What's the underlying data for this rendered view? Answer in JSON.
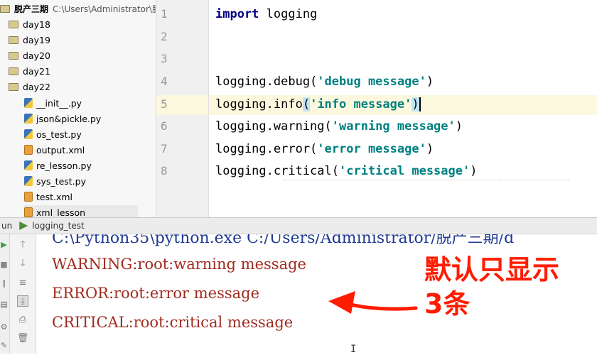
{
  "project_tree": {
    "root_label": "脱产三期",
    "root_path": "C:\\Users\\Administrator\\脱",
    "items": [
      {
        "label": "day18",
        "type": "folder"
      },
      {
        "label": "day19",
        "type": "folder"
      },
      {
        "label": "day20",
        "type": "folder"
      },
      {
        "label": "day21",
        "type": "folder"
      },
      {
        "label": "day22",
        "type": "folder"
      },
      {
        "label": "__init__.py",
        "type": "py"
      },
      {
        "label": "json&pickle.py",
        "type": "py"
      },
      {
        "label": "os_test.py",
        "type": "py"
      },
      {
        "label": "output.xml",
        "type": "xml"
      },
      {
        "label": "re_lesson.py",
        "type": "py"
      },
      {
        "label": "sys_test.py",
        "type": "py"
      },
      {
        "label": "test.xml",
        "type": "xml"
      },
      {
        "label": "xml_lesson",
        "type": "xml"
      }
    ]
  },
  "editor": {
    "line_numbers": [
      "1",
      "2",
      "3",
      "4",
      "5",
      "6",
      "7",
      "8"
    ],
    "lines": {
      "l1_kw": "import",
      "l1_rest": " logging",
      "l4_pre": "logging.debug(",
      "l4_str": "'debug message'",
      "l4_post": ")",
      "l5_pre": "logging.info",
      "l5_open": "(",
      "l5_str": "'info message'",
      "l5_close": ")",
      "l6_pre": "logging.warning(",
      "l6_str": "'warning message'",
      "l6_post": ")",
      "l7_pre": "logging.error(",
      "l7_str": "'error message'",
      "l7_post": ")",
      "l8_pre": "logging.critical(",
      "l8_str": "'critical message'",
      "l8_post": ")"
    }
  },
  "run_panel": {
    "tab_prefix": "un",
    "tab_title": "logging_test",
    "command_line": "C:\\Python35\\python.exe C:/Users/Administrator/脱产三期/d",
    "output": [
      "WARNING:root:warning message",
      "ERROR:root:error message",
      "CRITICAL:root:critical message"
    ]
  },
  "annotation": {
    "line1": "默认只显示",
    "line2": "3条",
    "color": "#ff1c00"
  }
}
